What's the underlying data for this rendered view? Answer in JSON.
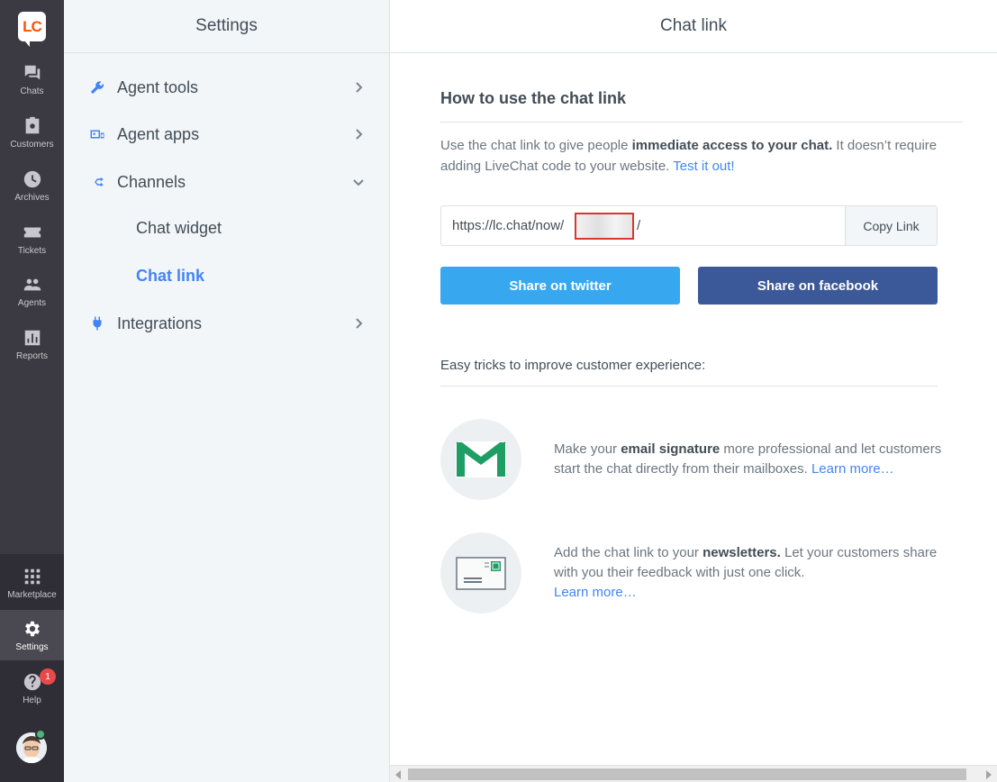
{
  "rail": {
    "logo": "LC",
    "items": [
      {
        "label": "Chats",
        "icon": "chat-bubbles-icon"
      },
      {
        "label": "Customers",
        "icon": "customers-icon"
      },
      {
        "label": "Archives",
        "icon": "clock-icon"
      },
      {
        "label": "Tickets",
        "icon": "ticket-icon"
      },
      {
        "label": "Agents",
        "icon": "agents-icon"
      },
      {
        "label": "Reports",
        "icon": "bar-chart-icon"
      }
    ],
    "bottom": [
      {
        "label": "Marketplace",
        "icon": "grid-icon"
      },
      {
        "label": "Settings",
        "icon": "gear-icon"
      },
      {
        "label": "Help",
        "icon": "help-icon",
        "badge": "1"
      }
    ]
  },
  "settings": {
    "title": "Settings",
    "nav": [
      {
        "label": "Agent tools",
        "icon": "wrench-icon",
        "chevron": "right"
      },
      {
        "label": "Agent apps",
        "icon": "apps-icon",
        "chevron": "right"
      },
      {
        "label": "Channels",
        "icon": "channels-icon",
        "chevron": "down"
      },
      {
        "label": "Integrations",
        "icon": "plug-icon",
        "chevron": "right"
      }
    ],
    "sub_items": [
      "Chat widget",
      "Chat link"
    ],
    "active_sub": "Chat link"
  },
  "main": {
    "title": "Chat link",
    "section_title": "How to use the chat link",
    "desc_1": "Use the chat link to give people ",
    "desc_bold": "immediate access to your chat.",
    "desc_2": " It doesn’t require adding LiveChat code to your website. ",
    "desc_link": "Test it out!",
    "url_prefix": "https://lc.chat/now/",
    "url_suffix": "/",
    "copy_label": "Copy Link",
    "share_twitter": "Share on twitter",
    "share_facebook": "Share on facebook",
    "tricks_title": "Easy tricks to improve customer experience:",
    "trick1_pre": "Make your ",
    "trick1_bold": "email signature",
    "trick1_post": " more professional and let customers start the chat directly from their mailboxes. ",
    "trick1_link": "Learn more…",
    "trick2_pre": "Add the chat link to your ",
    "trick2_bold": "newsletters.",
    "trick2_post": " Let your customers share with you their feedback with just one click.",
    "trick2_link": "Learn more…"
  },
  "colors": {
    "accent": "#4384f5",
    "twitter": "#37a8ef",
    "facebook": "#3b5898",
    "rail_bg": "#3b3a42"
  }
}
